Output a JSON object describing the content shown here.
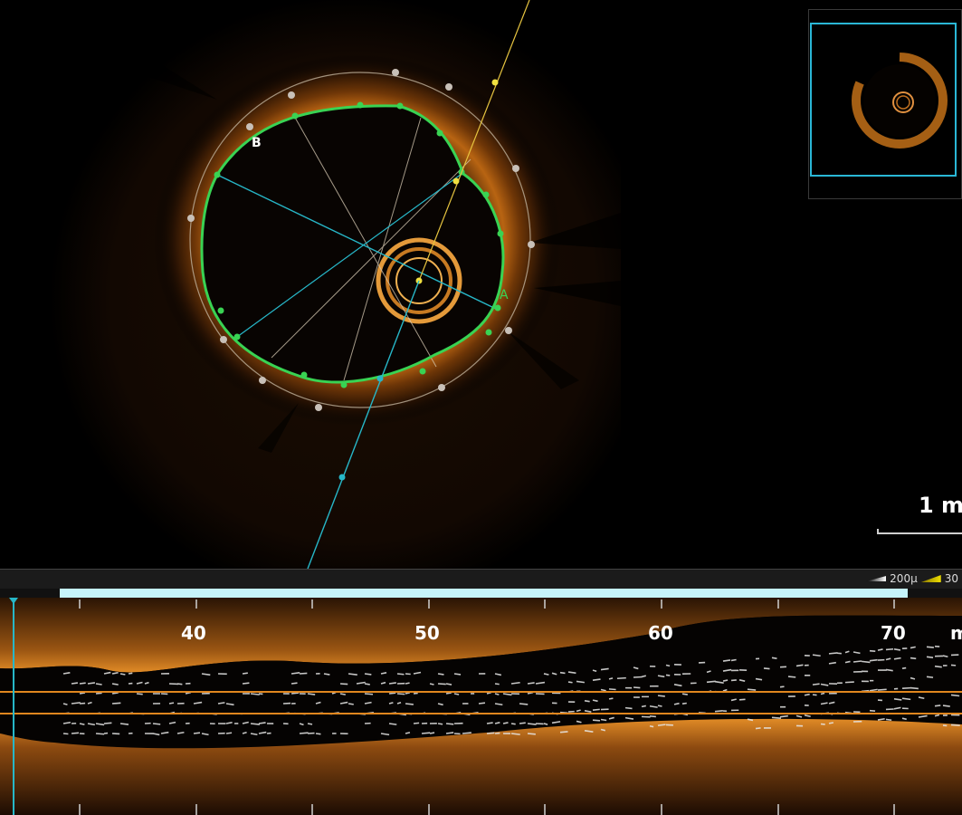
{
  "cross_section": {
    "marker_a": "A",
    "marker_b": "B",
    "scale_label": "1 m"
  },
  "legend": {
    "thickness_label": "200μ",
    "second_label": "30"
  },
  "pullback": {
    "progress": 0.94
  },
  "longitudinal": {
    "ticks": [
      "40",
      "50",
      "60",
      "70"
    ],
    "unit_label": "m"
  },
  "colors": {
    "lumen_contour": "#39d353",
    "guide_line": "#27b7c8",
    "marker_yellow": "#f0e040",
    "tissue": "#d7801e",
    "progress": "#c6f3fb"
  }
}
